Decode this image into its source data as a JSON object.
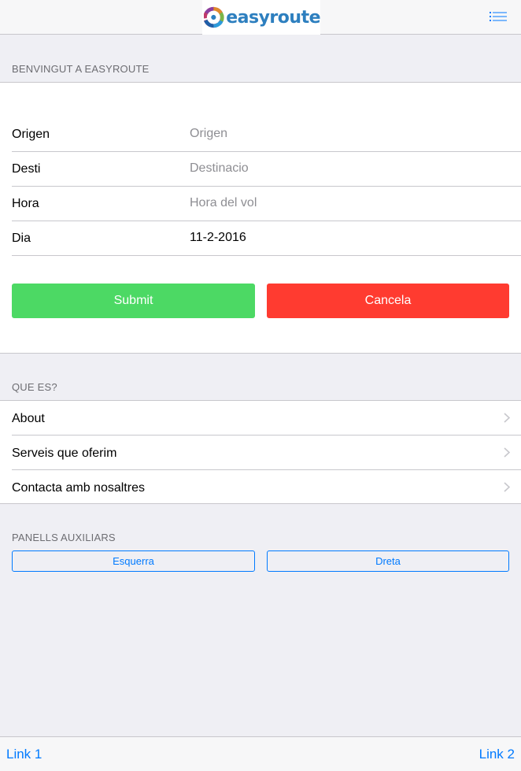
{
  "header": {
    "logo_text": "easyroute",
    "menu_icon": "list-menu-icon"
  },
  "welcome": {
    "title": "BENVINGUT A EASYROUTE",
    "form": {
      "origen": {
        "label": "Origen",
        "placeholder": "Origen",
        "value": ""
      },
      "desti": {
        "label": "Desti",
        "placeholder": "Destinacio",
        "value": ""
      },
      "hora": {
        "label": "Hora",
        "placeholder": "Hora del vol",
        "value": ""
      },
      "dia": {
        "label": "Dia",
        "placeholder": "",
        "value": "11-2-2016"
      }
    },
    "submit_label": "Submit",
    "cancel_label": "Cancela",
    "submit_color": "#4cd964",
    "cancel_color": "#ff3b30"
  },
  "about_section": {
    "title": "QUE ES?",
    "items": [
      {
        "label": "About"
      },
      {
        "label": "Serveis que oferim"
      },
      {
        "label": "Contacta amb nosaltres"
      }
    ]
  },
  "panels": {
    "title": "PANELLS AUXILIARS",
    "left_label": "Esquerra",
    "right_label": "Dreta"
  },
  "footer": {
    "link1": "Link 1",
    "link2": "Link 2"
  }
}
